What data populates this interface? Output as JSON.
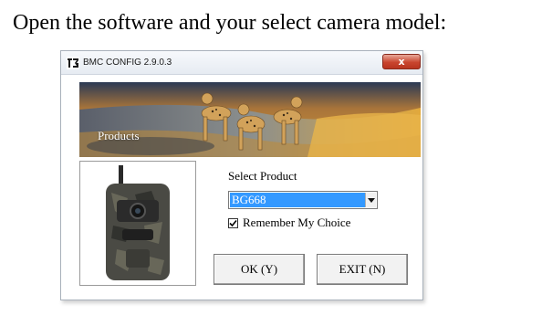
{
  "caption": "Open the software and your select camera model:",
  "window": {
    "title": "BMC CONFIG 2.9.0.3",
    "close_label": "x",
    "app_icon": "app-logo-icon"
  },
  "banner": {
    "label": "Products",
    "image": "cheetahs-banner-image"
  },
  "product_image": "trail-camera-image",
  "form": {
    "select_label": "Select Product",
    "selected_product": "BG668",
    "remember_checked": true,
    "remember_label": "Remember My Choice"
  },
  "buttons": {
    "ok_label": "OK (Y)",
    "exit_label": "EXIT (N)"
  },
  "colors": {
    "selection": "#3399ff",
    "close_button": "#c9452e"
  }
}
